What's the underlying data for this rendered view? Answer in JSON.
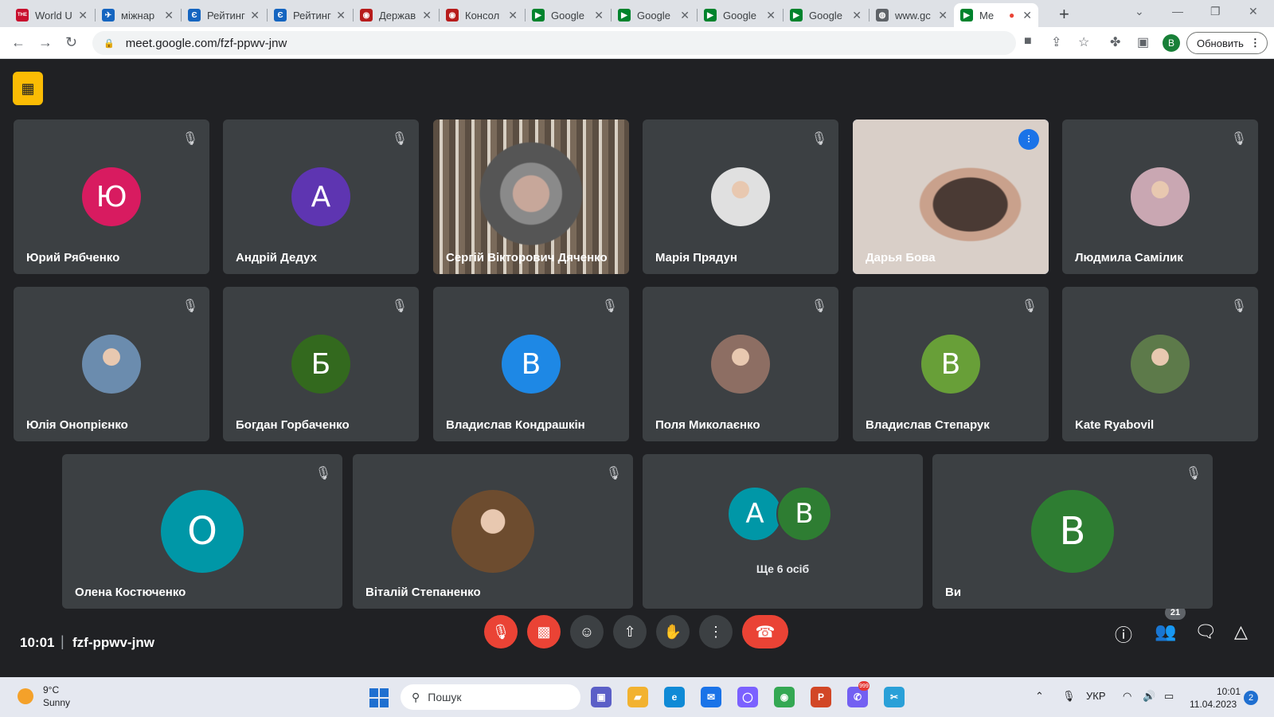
{
  "browser": {
    "tabs": [
      {
        "label": "World U",
        "icon": "the-icon",
        "color": "#c8102e",
        "glyph": "THE"
      },
      {
        "label": "міжнар",
        "icon": "bird-icon",
        "color": "#1565c0",
        "glyph": "✈"
      },
      {
        "label": "Рейтинг",
        "icon": "e-icon",
        "color": "#1565c0",
        "glyph": "Є"
      },
      {
        "label": "Рейтинг",
        "icon": "e-icon",
        "color": "#1565c0",
        "glyph": "Є"
      },
      {
        "label": "Держав",
        "icon": "seal-icon",
        "color": "#b71c1c",
        "glyph": "◉"
      },
      {
        "label": "Консол",
        "icon": "seal-icon",
        "color": "#b71c1c",
        "glyph": "◉"
      },
      {
        "label": "Google",
        "icon": "meet-icon",
        "color": "#00832d",
        "glyph": "▶"
      },
      {
        "label": "Google",
        "icon": "meet-icon",
        "color": "#00832d",
        "glyph": "▶"
      },
      {
        "label": "Google",
        "icon": "meet-icon",
        "color": "#00832d",
        "glyph": "▶"
      },
      {
        "label": "Google",
        "icon": "meet-icon",
        "color": "#00832d",
        "glyph": "▶"
      },
      {
        "label": "www.gc",
        "icon": "globe-icon",
        "color": "#5f6368",
        "glyph": "◍"
      },
      {
        "label": "Me",
        "icon": "meet-icon",
        "color": "#00832d",
        "glyph": "▶",
        "active": true
      }
    ],
    "new_tab": "+",
    "url": "meet.google.com/fzf-ppwv-jnw",
    "profile_initial": "B",
    "update_label": "Обновить"
  },
  "participants": [
    {
      "name": "Юрий Рябченко",
      "initial": "Ю",
      "avatar_color": "#d81b60",
      "muted": true
    },
    {
      "name": "Андрій Дедух",
      "initial": "А",
      "avatar_color": "#5e35b1",
      "muted": true
    },
    {
      "name": "Сергій Вікторович Дяченко",
      "initial": "",
      "avatar_color": "#5a5450",
      "muted": false,
      "video": true
    },
    {
      "name": "Марія Прядун",
      "initial": "",
      "avatar_color": "#e0e0e0",
      "muted": true,
      "photo": true
    },
    {
      "name": "Дарья Бова",
      "initial": "",
      "avatar_color": "#8a7060",
      "muted": false,
      "video": true,
      "speaking": true
    },
    {
      "name": "Людмила Самілик",
      "initial": "",
      "avatar_color": "#c9a7b2",
      "muted": true,
      "photo": true
    },
    {
      "name": "Юлія Онопрієнко",
      "initial": "",
      "avatar_color": "#6b8cae",
      "muted": true,
      "photo": true
    },
    {
      "name": "Богдан Горбаченко",
      "initial": "Б",
      "avatar_color": "#33691e",
      "muted": true
    },
    {
      "name": "Владислав Кондрашкін",
      "initial": "В",
      "avatar_color": "#1e88e5",
      "muted": true
    },
    {
      "name": "Поля Миколаєнко",
      "initial": "",
      "avatar_color": "#8d6e63",
      "muted": true,
      "photo": true
    },
    {
      "name": "Владислав Степарук",
      "initial": "В",
      "avatar_color": "#689f38",
      "muted": true
    },
    {
      "name": "Kate Ryabovil",
      "initial": "",
      "avatar_color": "#5d7a4a",
      "muted": true,
      "photo": true
    },
    {
      "name": "Олена Костюченко",
      "initial": "О",
      "avatar_color": "#0097a7",
      "muted": true
    },
    {
      "name": "Віталій Степаненко",
      "initial": "",
      "avatar_color": "#6d4c2f",
      "muted": true,
      "photo": true
    },
    {
      "name": "Ви",
      "initial": "В",
      "avatar_color": "#2e7d32",
      "muted": true
    }
  ],
  "more": {
    "label": "Ще 6 осіб",
    "initials": [
      "А",
      "В"
    ],
    "colors": [
      "#0097a7",
      "#2e7d32"
    ]
  },
  "meeting": {
    "time": "10:01",
    "separator": "|",
    "code": "fzf-ppwv-jnw",
    "people_count": "21"
  },
  "taskbar": {
    "temperature": "9°C",
    "condition": "Sunny",
    "search_placeholder": "Пошук",
    "language": "УКР",
    "clock_time": "10:01",
    "clock_date": "11.04.2023",
    "notifications": "2",
    "viber_badge": "999"
  }
}
